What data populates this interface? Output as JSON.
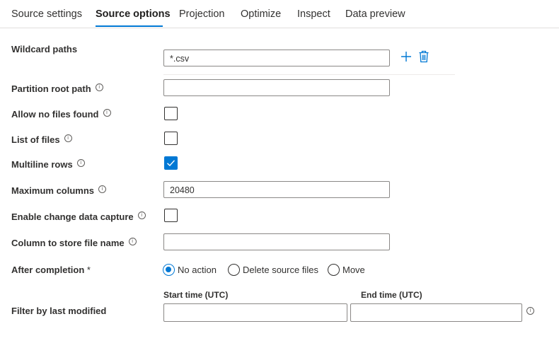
{
  "tabs": [
    {
      "label": "Source settings",
      "active": false
    },
    {
      "label": "Source options",
      "active": true
    },
    {
      "label": "Projection",
      "active": false
    },
    {
      "label": "Optimize",
      "active": false
    },
    {
      "label": "Inspect",
      "active": false
    },
    {
      "label": "Data preview",
      "active": false
    }
  ],
  "fields": {
    "wildcard_paths": {
      "label": "Wildcard paths",
      "value": "*.csv"
    },
    "partition_root_path": {
      "label": "Partition root path",
      "value": ""
    },
    "allow_no_files": {
      "label": "Allow no files found",
      "checked": false
    },
    "list_of_files": {
      "label": "List of files",
      "checked": false
    },
    "multiline_rows": {
      "label": "Multiline rows",
      "checked": true
    },
    "maximum_columns": {
      "label": "Maximum columns",
      "value": "20480"
    },
    "enable_cdc": {
      "label": "Enable change data capture",
      "checked": false
    },
    "column_file_name": {
      "label": "Column to store file name",
      "value": ""
    },
    "after_completion": {
      "label": "After completion",
      "required_mark": "*",
      "options": [
        "No action",
        "Delete source files",
        "Move"
      ],
      "selected": "No action"
    },
    "filter_last_modified": {
      "label": "Filter by last modified",
      "start_label": "Start time (UTC)",
      "end_label": "End time (UTC)",
      "start_value": "",
      "end_value": ""
    }
  },
  "icons": {
    "add": "plus-icon",
    "delete": "trash-icon",
    "info": "info-icon",
    "check": "checkmark-icon"
  },
  "colors": {
    "accent": "#0078d4",
    "text": "#323130",
    "border": "#8a8886"
  }
}
